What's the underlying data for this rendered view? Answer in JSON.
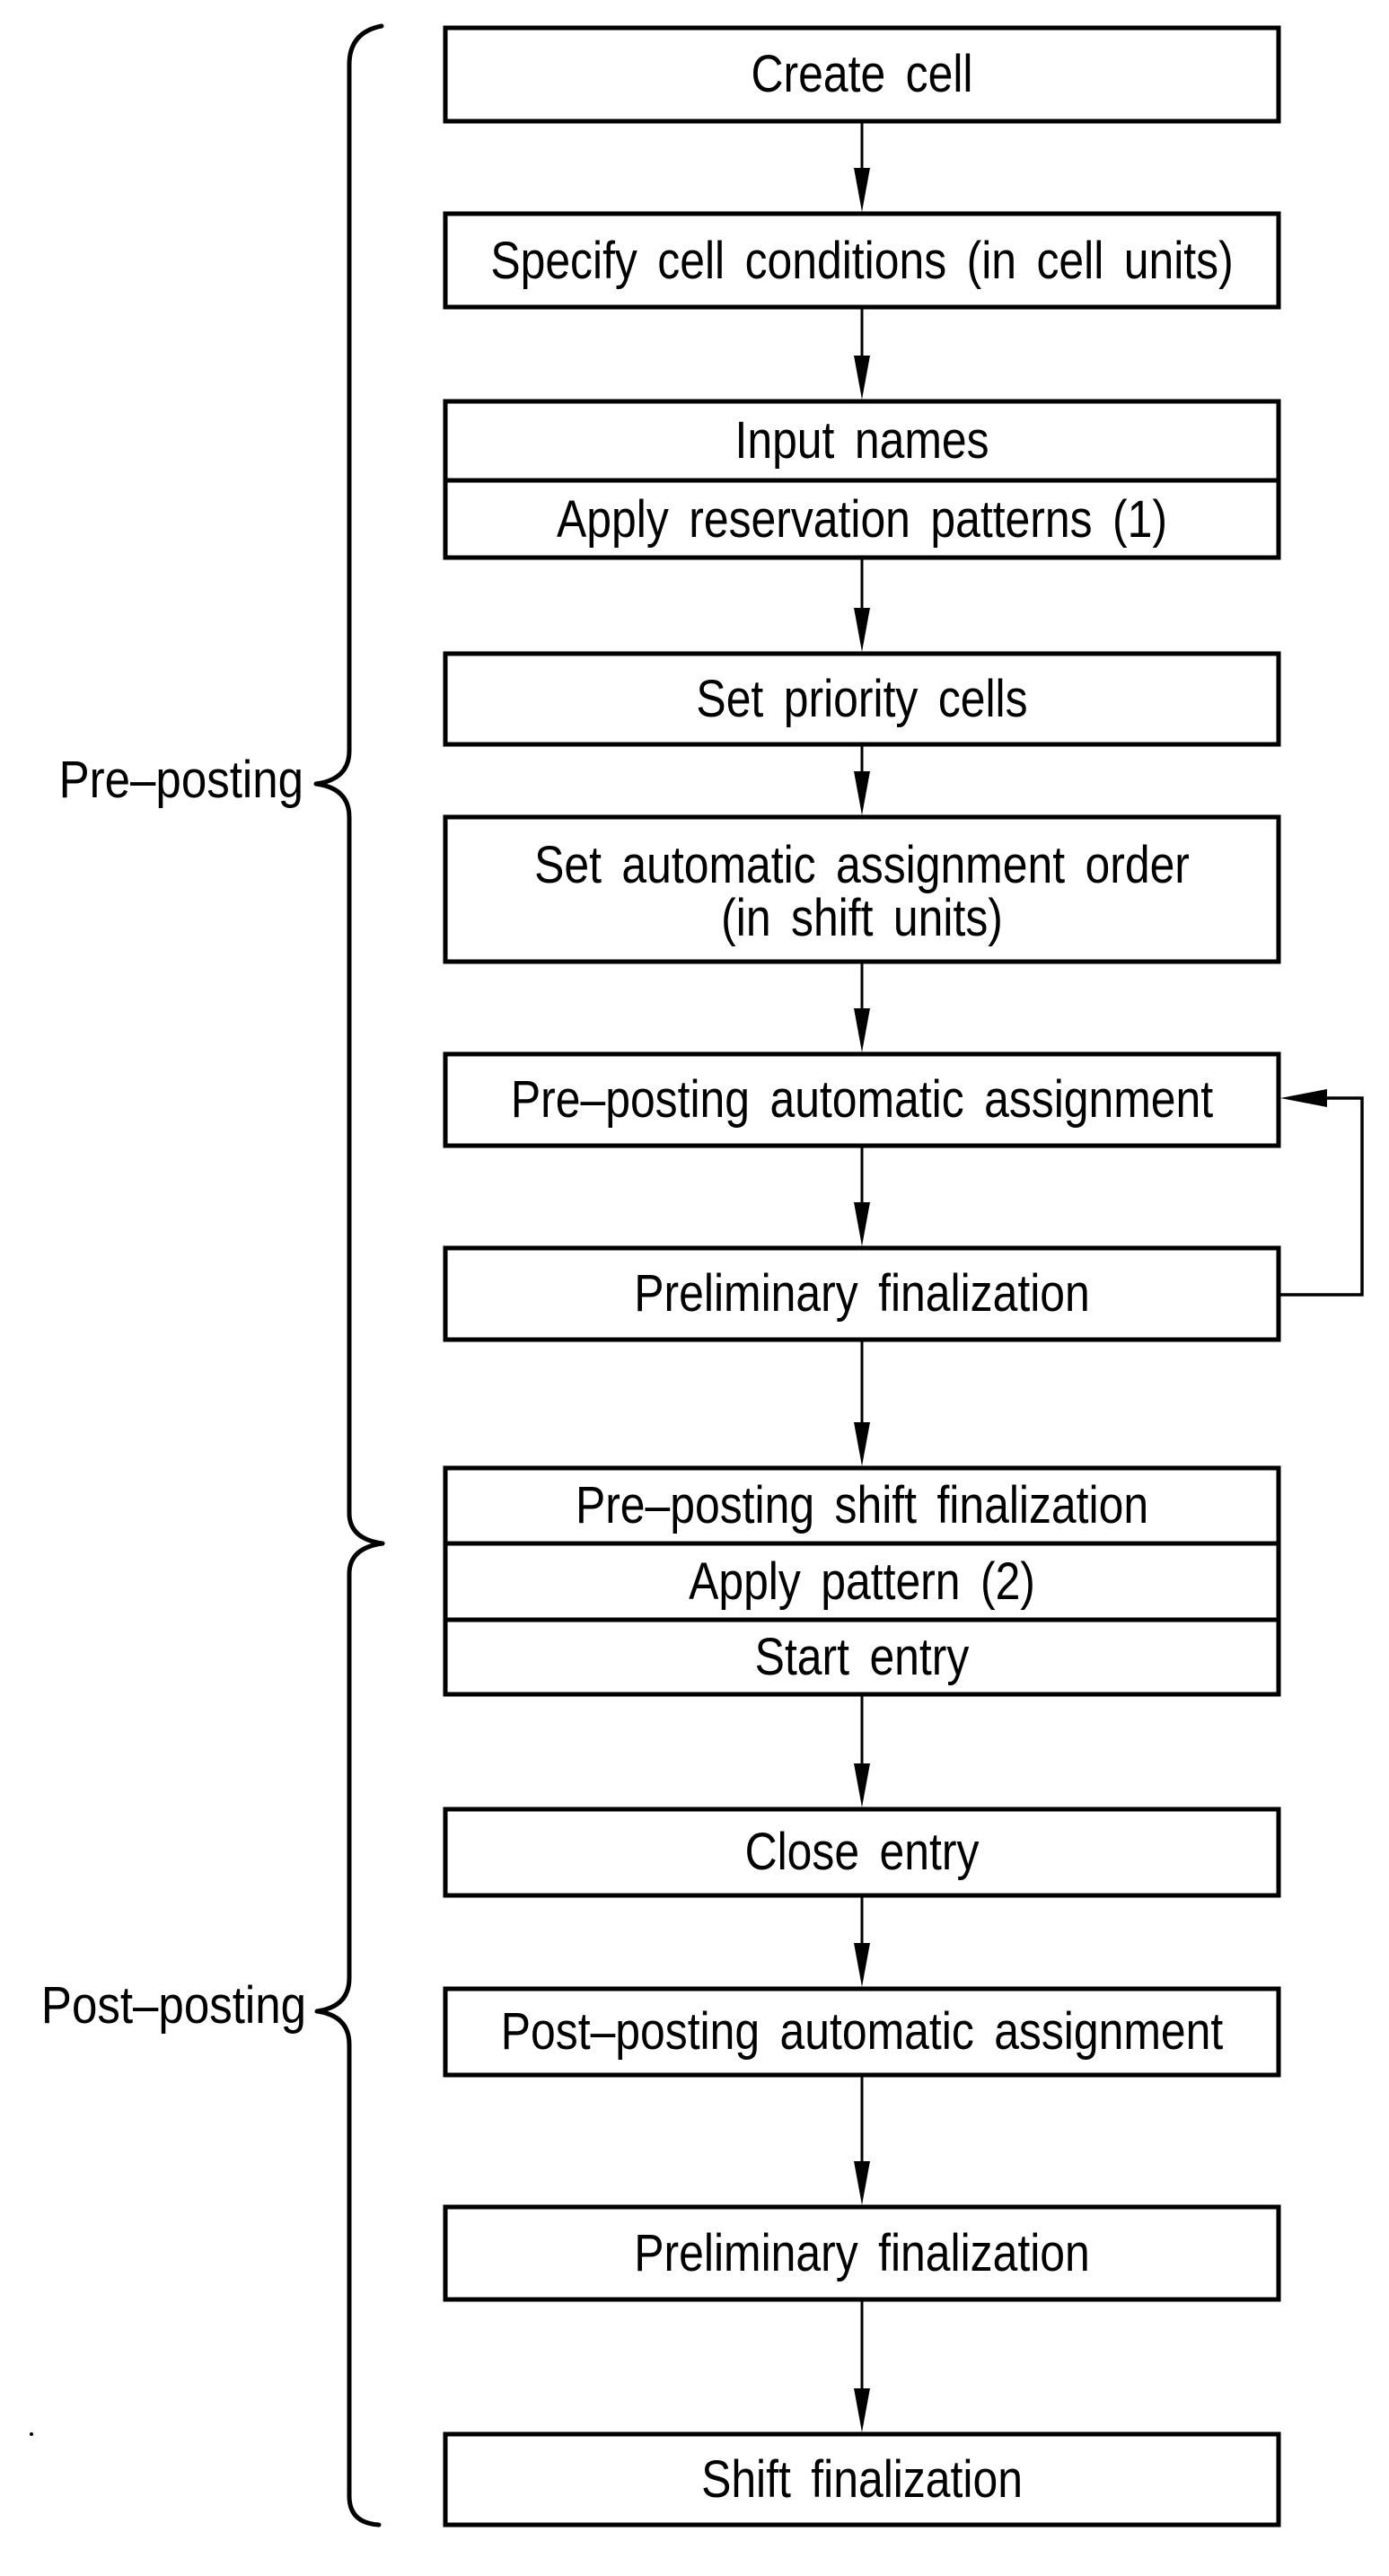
{
  "diagram": {
    "phases": [
      {
        "label": "Pre–posting"
      },
      {
        "label": "Post–posting"
      }
    ],
    "steps": [
      {
        "label": "Create cell"
      },
      {
        "label": "Specify cell conditions (in cell units)"
      },
      {
        "rows": [
          "Input names",
          "Apply reservation patterns (1)"
        ]
      },
      {
        "label": "Set priority cells"
      },
      {
        "lines": [
          "Set automatic assignment order",
          "(in shift units)"
        ]
      },
      {
        "label": "Pre–posting automatic assignment"
      },
      {
        "label": "Preliminary finalization"
      },
      {
        "rows": [
          "Pre–posting shift finalization",
          "Apply pattern (2)",
          "Start entry"
        ]
      },
      {
        "label": "Close entry"
      },
      {
        "label": "Post–posting automatic assignment"
      },
      {
        "label": "Preliminary finalization"
      },
      {
        "label": "Shift finalization"
      }
    ],
    "feedback_loop": {
      "from": "Preliminary finalization",
      "to": "Pre–posting automatic assignment"
    }
  }
}
